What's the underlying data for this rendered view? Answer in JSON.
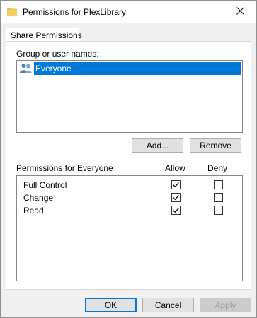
{
  "window": {
    "title": "Permissions for PlexLibrary"
  },
  "tabs": [
    {
      "label": "Share Permissions",
      "active": true
    }
  ],
  "group_section": {
    "label": "Group or user names:",
    "items": [
      {
        "name": "Everyone",
        "selected": true,
        "icon": "users-icon"
      }
    ],
    "add_label": "Add...",
    "remove_label": "Remove"
  },
  "permissions_section": {
    "header_label": "Permissions for Everyone",
    "allow_header": "Allow",
    "deny_header": "Deny",
    "rows": [
      {
        "name": "Full Control",
        "allow": true,
        "deny": false
      },
      {
        "name": "Change",
        "allow": true,
        "deny": false
      },
      {
        "name": "Read",
        "allow": true,
        "deny": false
      }
    ]
  },
  "footer": {
    "ok_label": "OK",
    "cancel_label": "Cancel",
    "apply_label": "Apply"
  },
  "colors": {
    "selection": "#0078d7",
    "folder": "#e8b84a"
  }
}
